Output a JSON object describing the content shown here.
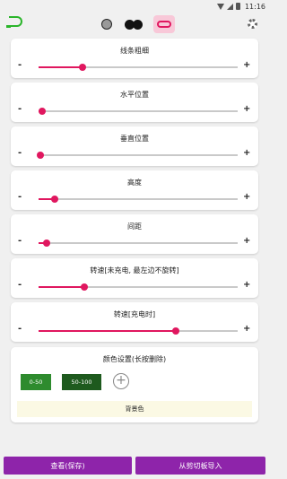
{
  "status_bar": {
    "time": "11:16"
  },
  "sliders": [
    {
      "label": "线条粗细",
      "level": 0.22
    },
    {
      "label": "水平位置",
      "level": 0.02
    },
    {
      "label": "垂直位置",
      "level": 0.01
    },
    {
      "label": "高度",
      "level": 0.08
    },
    {
      "label": "间距",
      "level": 0.04
    },
    {
      "label": "转速[未充电, 最左边不旋转]",
      "level": 0.23
    },
    {
      "label": "转速[充电时]",
      "level": 0.69
    }
  ],
  "controls": {
    "minus": "-",
    "plus": "+"
  },
  "color_settings": {
    "title": "颜色设置(长按删除)",
    "chips": [
      {
        "label": "0-50",
        "color": "#2e8b2e"
      },
      {
        "label": "50-100",
        "color": "#1e5a1e"
      }
    ],
    "add_symbol": "+",
    "background_label": "背景色"
  },
  "buttons": {
    "view_save": "查看(保存)",
    "import_clipboard": "从剪切板导入"
  },
  "colors": {
    "accent": "#e0175f",
    "brand": "#2ab52a",
    "button": "#8e24aa"
  },
  "icons": [
    "logo-icon",
    "style-dot-icon",
    "style-pair-icon",
    "style-pill-icon",
    "gear-icon",
    "wifi-icon",
    "signal-icon",
    "battery-icon",
    "add-color-icon"
  ]
}
